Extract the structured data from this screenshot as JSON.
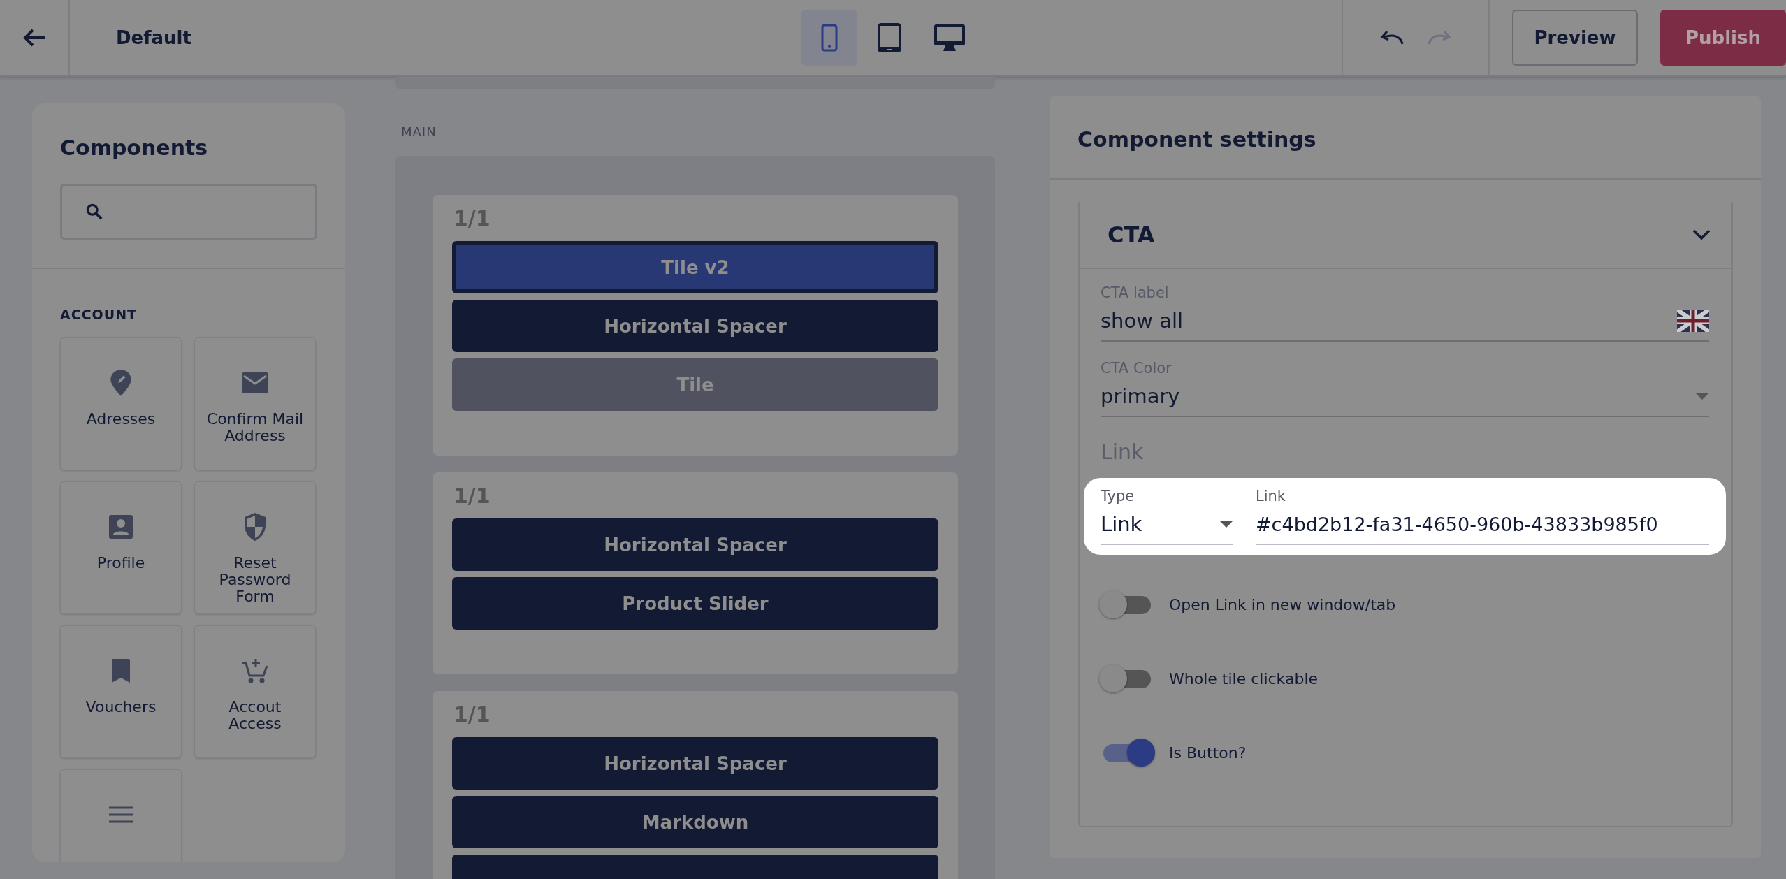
{
  "topbar": {
    "title": "Default",
    "devices": [
      {
        "kind": "phone",
        "selected": true
      },
      {
        "kind": "tablet",
        "selected": false
      },
      {
        "kind": "desktop",
        "selected": false
      }
    ],
    "undo_disabled": false,
    "redo_disabled": true,
    "preview": "Preview",
    "publish": "Publish"
  },
  "components_panel": {
    "title": "Components",
    "category": "ACCOUNT",
    "items": [
      {
        "label": "Adresses",
        "kind": "pin"
      },
      {
        "label": "Confirm Mail Address",
        "kind": "mail"
      },
      {
        "label": "Profile",
        "kind": "profile"
      },
      {
        "label": "Reset Password Form",
        "kind": "shield"
      },
      {
        "label": "Vouchers",
        "kind": "bookmark"
      },
      {
        "label": "Accout Access",
        "kind": "cart"
      },
      {
        "kind": "menu"
      }
    ]
  },
  "canvas": {
    "area": "MAIN",
    "sections": [
      {
        "label": "1/1",
        "items": [
          {
            "label": "Tile v2",
            "selected": true,
            "disabled": false
          },
          {
            "label": "Horizontal Spacer",
            "selected": false,
            "disabled": false
          },
          {
            "label": "Tile",
            "selected": false,
            "disabled": true
          }
        ]
      },
      {
        "label": "1/1",
        "items": [
          {
            "label": "Horizontal Spacer",
            "selected": false,
            "disabled": false
          },
          {
            "label": "Product Slider",
            "selected": false,
            "disabled": false
          }
        ]
      },
      {
        "label": "1/1",
        "items": [
          {
            "label": "Horizontal Spacer",
            "selected": false,
            "disabled": false
          },
          {
            "label": "Markdown",
            "selected": false,
            "disabled": false
          },
          {
            "selected": false,
            "disabled": false
          }
        ]
      }
    ]
  },
  "settings": {
    "title": "Component settings",
    "group": {
      "title": "CTA",
      "expanded": true,
      "cta_label": {
        "label": "CTA label",
        "value": "show all"
      },
      "cta_color": {
        "label": "CTA Color",
        "value": "primary"
      },
      "link_heading": "Link",
      "link_type": {
        "label": "Type",
        "value": "Link"
      },
      "link": {
        "label": "Link",
        "value": "#c4bd2b12-fa31-4650-960b-43833b985f0"
      },
      "toggles": [
        {
          "label": "Open Link in new window/tab",
          "on": false
        },
        {
          "label": "Whole tile clickable",
          "on": false
        },
        {
          "label": "Is Button?",
          "on": true
        }
      ]
    }
  }
}
